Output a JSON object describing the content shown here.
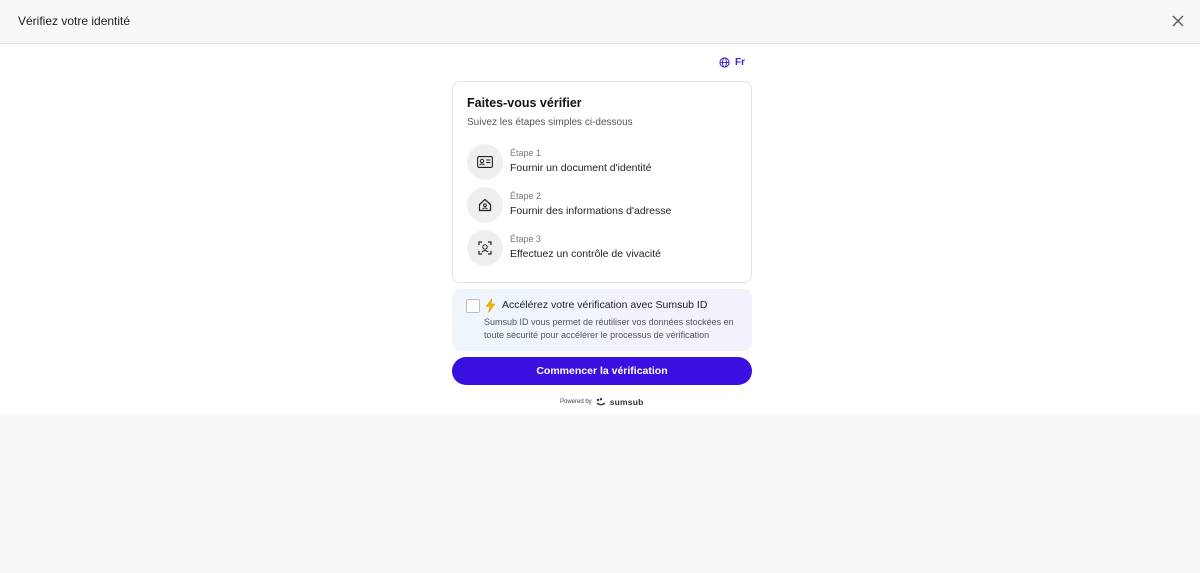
{
  "header": {
    "title": "Vérifiez votre identité"
  },
  "language": {
    "label": "Fr"
  },
  "card": {
    "title": "Faites-vous vérifier",
    "subtitle": "Suivez les étapes simples ci-dessous",
    "steps": [
      {
        "label": "Étape 1",
        "text": "Fournir un document d'identité",
        "icon": "id-card-icon"
      },
      {
        "label": "Étape 2",
        "text": "Fournir des informations d'adresse",
        "icon": "home-icon"
      },
      {
        "label": "Étape 3",
        "text": "Effectuez un contrôle de vivacité",
        "icon": "face-scan-icon"
      }
    ]
  },
  "sumsub_id": {
    "title": "Accélérez votre vérification avec Sumsub ID",
    "description": "Sumsub ID vous permet de réutiliser vos données stockées en toute sécurité pour accélérer le processus de vérification",
    "checked": false
  },
  "cta": {
    "label": "Commencer la vérification"
  },
  "footer": {
    "powered_by": "Powered by",
    "brand": "sumsub"
  },
  "colors": {
    "accent": "#3a10e0",
    "bolt": "#f2b705"
  }
}
